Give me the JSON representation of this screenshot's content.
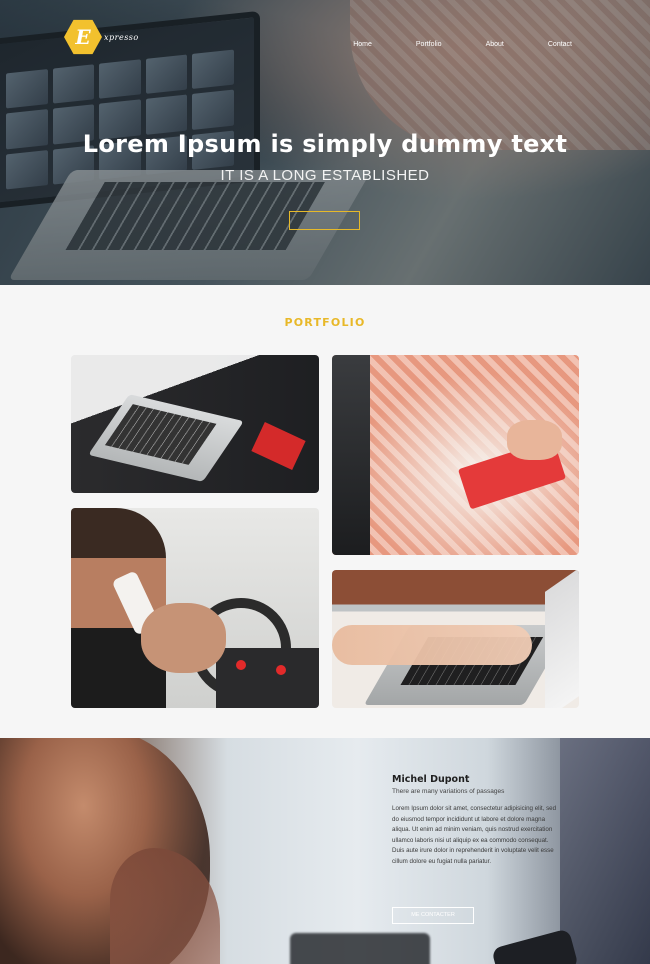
{
  "header": {
    "logo_letter": "E",
    "logo_word": "xpresso",
    "nav": [
      {
        "label": "Home"
      },
      {
        "label": "Portfolio"
      },
      {
        "label": "About"
      },
      {
        "label": "Contact"
      }
    ]
  },
  "hero": {
    "title": "Lorem Ipsum is simply dummy text",
    "subtitle": "IT IS A LONG ESTABLISHED",
    "button_label": ""
  },
  "portfolio": {
    "title": "PORTFOLIO",
    "items": [
      {
        "subject": "laptop-and-notebook"
      },
      {
        "subject": "woman-writing-in-notebook"
      },
      {
        "subject": "man-on-phone-in-car"
      },
      {
        "subject": "hands-typing-on-laptop"
      }
    ]
  },
  "about": {
    "name": "Michel Dupont",
    "tagline": "There are many variations of passages",
    "body": "Lorem Ipsum dolor sit amet, consectetur adipisicing elit, sed do eiusmod tempor incididunt ut labore et dolore magna aliqua. Ut enim ad minim veniam, quis nostrud exercitation ullamco laboris nisi ut aliquip ex ea commodo consequat. Duis aute irure dolor in reprehenderit in voluptate velit esse cillum dolore eu fugiat nulla pariatur.",
    "button_label": "ME CONTACTER"
  },
  "colors": {
    "accent": "#e8b828",
    "logo": "#f2c12e",
    "background": "#f6f6f6",
    "text_dark": "#1f1f1f"
  }
}
